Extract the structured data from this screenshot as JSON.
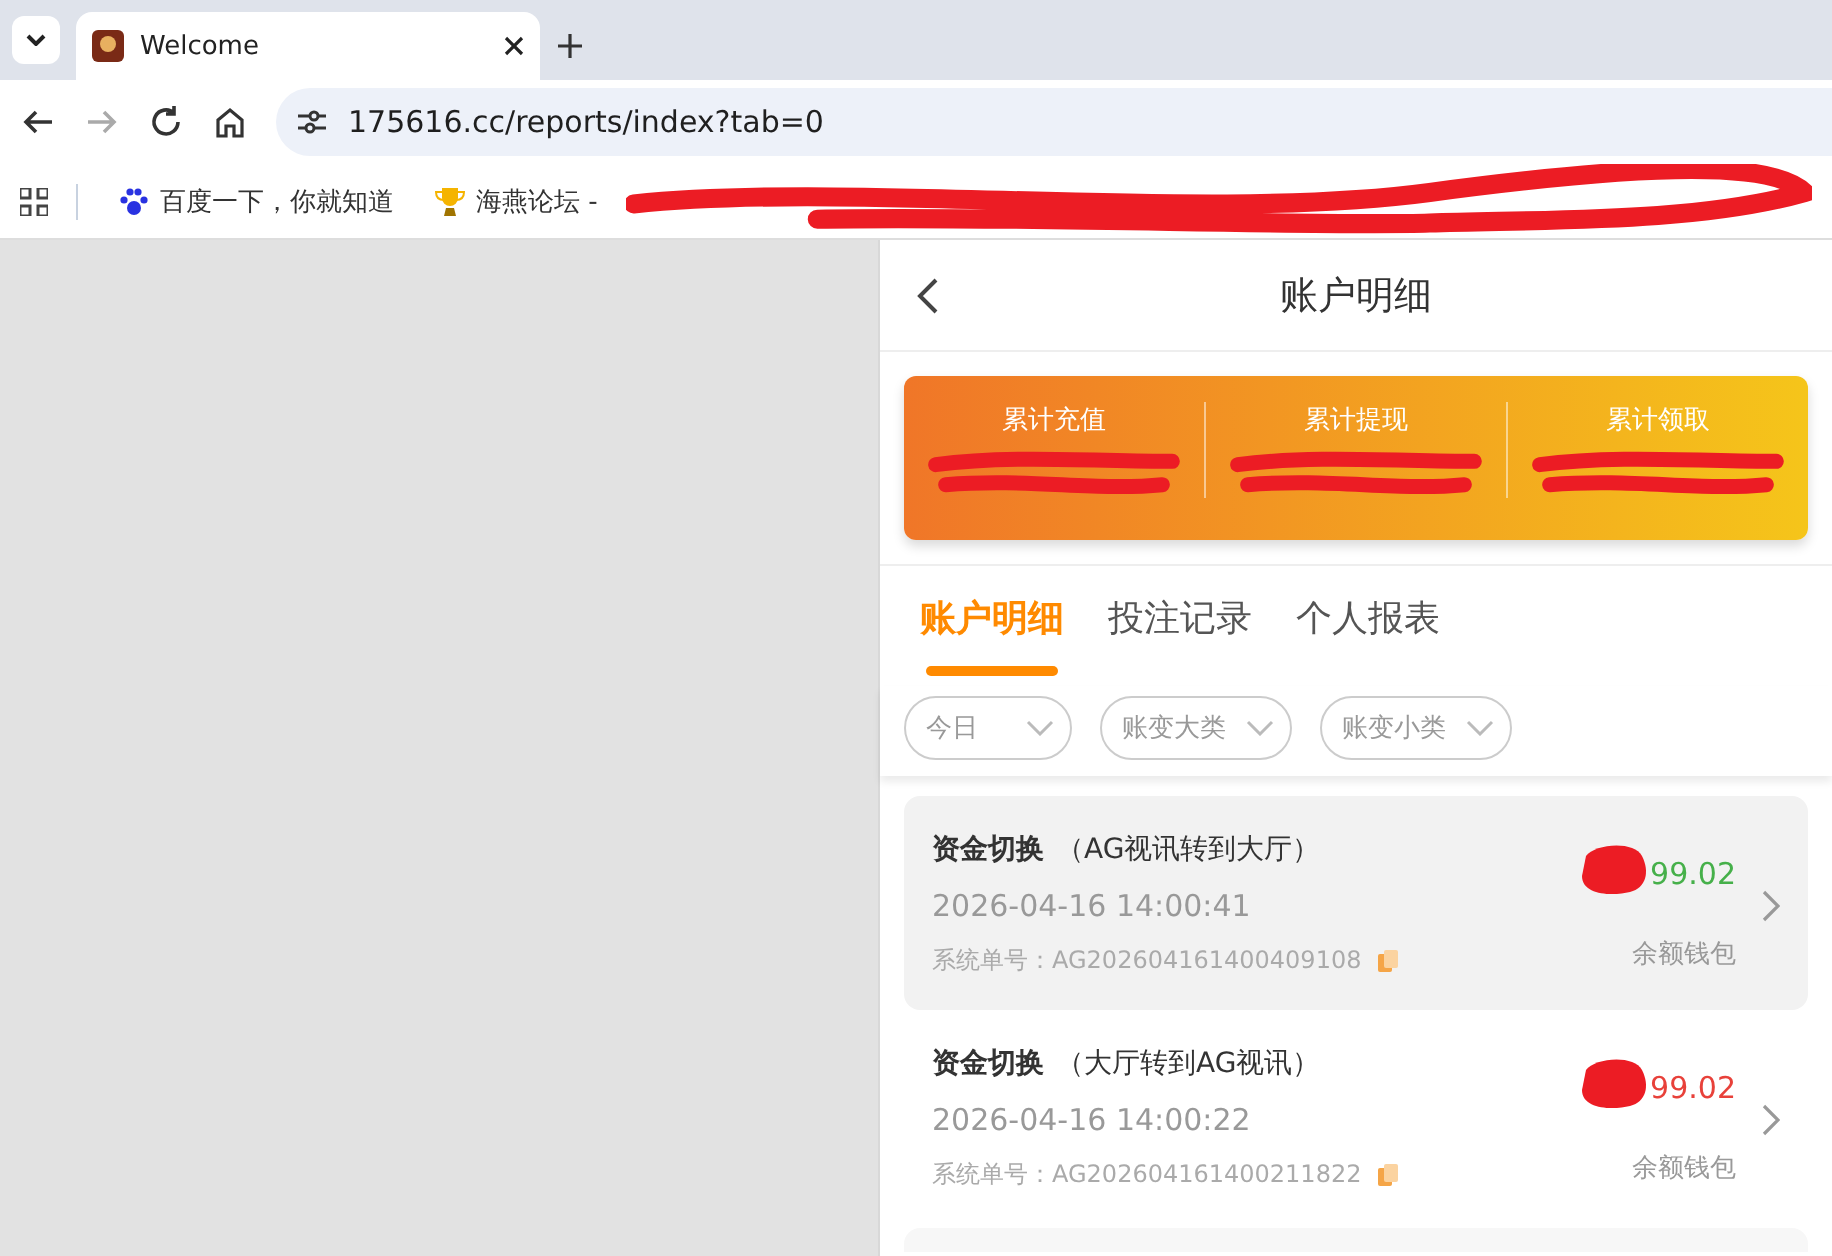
{
  "browser": {
    "tab": {
      "title": "Welcome",
      "selected": true
    },
    "address": "175616.cc/reports/index?tab=0",
    "forward_disabled": true,
    "bookmarks": [
      {
        "label": "百度一下，你就知道",
        "kind": "paw"
      },
      {
        "label": "海燕论坛 -",
        "kind": "trophy"
      },
      {
        "kind": "redacted"
      }
    ]
  },
  "page": {
    "title": "账户明细",
    "summary": [
      {
        "label": "累计充值",
        "redacted": true
      },
      {
        "label": "累计提现",
        "redacted": true
      },
      {
        "label": "累计领取",
        "redacted": true
      }
    ],
    "tabs": [
      {
        "label": "账户明细",
        "selected": true
      },
      {
        "label": "投注记录",
        "selected": false
      },
      {
        "label": "个人报表",
        "selected": false
      }
    ],
    "filters": [
      {
        "label": "今日"
      },
      {
        "label": "账变大类"
      },
      {
        "label": "账变小类"
      }
    ],
    "records": [
      {
        "title": "资金切换",
        "detail": "（AG视讯转到大厅）",
        "time": "2026-04-16 14:00:41",
        "order_label": "系统单号：",
        "order": "AG202604161400409108",
        "amount": "99.02",
        "amount_redacted": true,
        "kind": "credit",
        "wallet": "余额钱包",
        "highlighted": true
      },
      {
        "title": "资金切换",
        "detail": "（大厅转到AG视讯）",
        "time": "2026-04-16 14:00:22",
        "order_label": "系统单号：",
        "order": "AG202604161400211822",
        "amount": "99.02",
        "amount_redacted": true,
        "kind": "debit",
        "wallet": "余额钱包",
        "highlighted": false
      }
    ]
  }
}
